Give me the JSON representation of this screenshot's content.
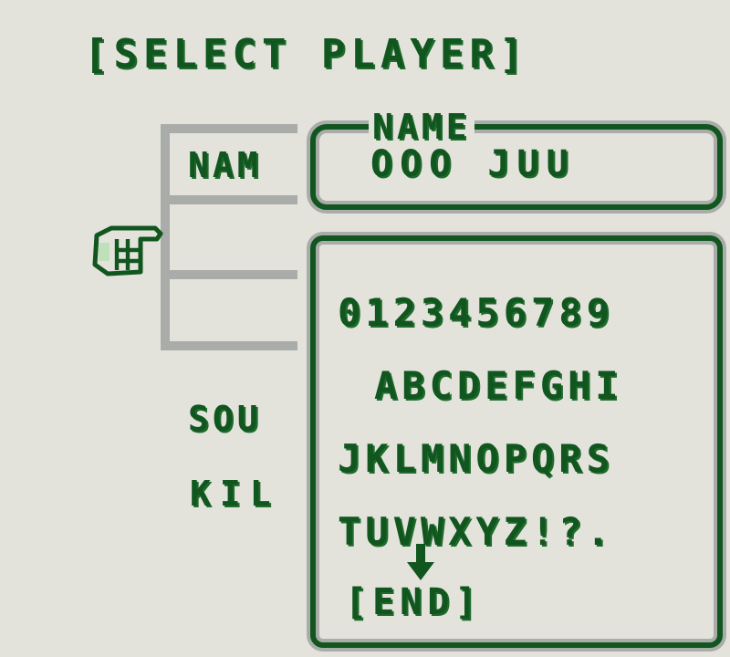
{
  "screen": {
    "title": "[SELECT PLAYER]"
  },
  "slots": [
    {
      "label": "NAM"
    },
    {
      "label": ""
    },
    {
      "label": ""
    }
  ],
  "options": {
    "sound_label": "SOU",
    "kill_label": "KIL"
  },
  "name_entry": {
    "legend": "NAME",
    "value": "OOO JUU"
  },
  "keyboard": {
    "rows": [
      "0123456789",
      "ABCDEFGHI",
      "JKLMNOPQRS",
      "TUVWXYZ!?."
    ],
    "end_label": "[END]"
  },
  "cursor": {
    "pointer_icon": "hand-pointer-icon",
    "selection_icon": "down-arrow-icon"
  },
  "colors": {
    "background": "#e3e3dc",
    "text_green": "#10561e",
    "frame_gray": "#a9aca8"
  }
}
